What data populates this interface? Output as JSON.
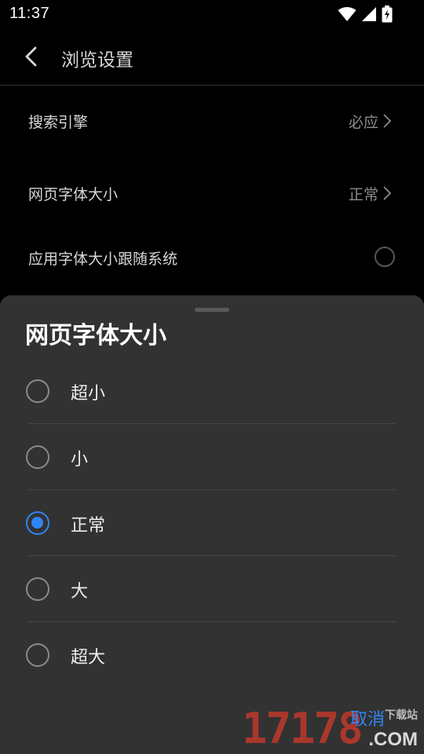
{
  "status_bar": {
    "time": "11:37",
    "icons": [
      "wifi-icon",
      "cell-signal-icon",
      "battery-charging-icon"
    ]
  },
  "header": {
    "title": "浏览设置",
    "back_icon": "back-arrow-icon"
  },
  "settings": {
    "search_engine": {
      "label": "搜索引擎",
      "value": "必应"
    },
    "font_size": {
      "label": "网页字体大小",
      "value": "正常"
    },
    "follow_system": {
      "label": "应用字体大小跟随系统",
      "checked": false
    }
  },
  "sheet": {
    "title": "网页字体大小",
    "options": [
      {
        "label": "超小",
        "selected": false
      },
      {
        "label": "小",
        "selected": false
      },
      {
        "label": "正常",
        "selected": true
      },
      {
        "label": "大",
        "selected": false
      },
      {
        "label": "超大",
        "selected": false
      }
    ],
    "cancel_label": "取消"
  },
  "watermark": {
    "number": "17178",
    "subtitle": "下载站",
    "domain": ".COM"
  },
  "colors": {
    "accent": "#2f86f6",
    "background": "#000000",
    "sheet": "#323232"
  }
}
